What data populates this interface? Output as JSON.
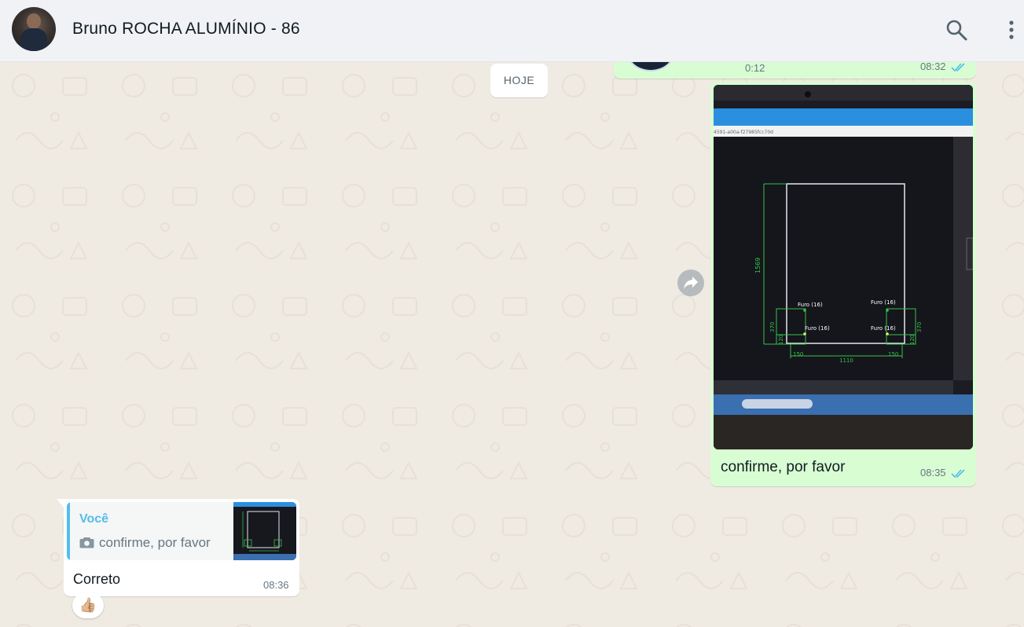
{
  "header": {
    "contact_name": "Bruno ROCHA ALUMÍNIO - 86",
    "icons": [
      "search-icon",
      "menu-icon"
    ]
  },
  "chat": {
    "date_chip": "HOJE",
    "audio_message": {
      "duration": "0:12",
      "time": "08:32",
      "status": "read"
    },
    "image_message": {
      "caption": "confirme, por favor",
      "time": "08:35",
      "status": "read",
      "photo_text": {
        "url_fragment": "4591-a00a-f27985fcc70d",
        "dim_height": "1569",
        "dim_width": "1110",
        "label_370": "370",
        "label_120": "120",
        "label_150": "150",
        "hole_label": "Furo (16)"
      }
    },
    "reply_message": {
      "quote_author": "Você",
      "quote_text": "confirme, por favor",
      "text": "Correto",
      "time": "08:36"
    },
    "reaction": "👍🏼"
  },
  "colors": {
    "outgoing_bubble": "#d9fdd3",
    "incoming_bubble": "#ffffff",
    "read_ticks": "#53bdeb",
    "chat_background": "#efeae2"
  }
}
